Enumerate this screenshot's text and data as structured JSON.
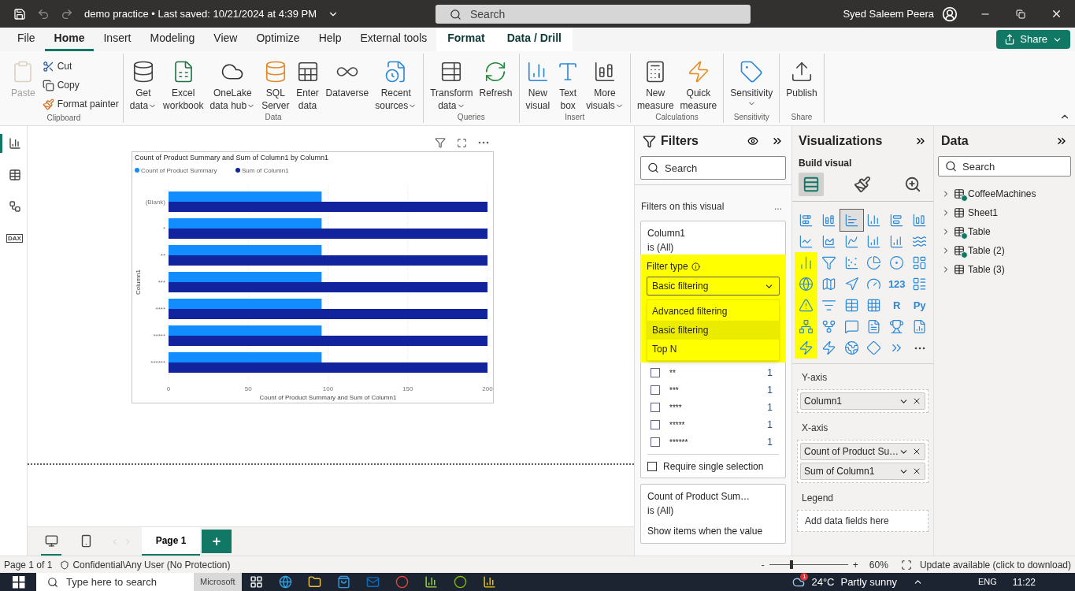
{
  "title_bar": {
    "title": "demo practice • Last saved: 10/21/2024 at 4:39 PM",
    "search": {
      "placeholder": "Search"
    },
    "user": "Syed Saleem Peera"
  },
  "ribbon_tabs": [
    {
      "label": "File",
      "kind": "normal",
      "selected": false
    },
    {
      "label": "Home",
      "kind": "normal",
      "selected": true
    },
    {
      "label": "Insert",
      "kind": "normal",
      "selected": false
    },
    {
      "label": "Modeling",
      "kind": "normal",
      "selected": false
    },
    {
      "label": "View",
      "kind": "normal",
      "selected": false
    },
    {
      "label": "Optimize",
      "kind": "normal",
      "selected": false
    },
    {
      "label": "Help",
      "kind": "normal",
      "selected": false
    },
    {
      "label": "External tools",
      "kind": "normal",
      "selected": false
    },
    {
      "label": "Format",
      "kind": "contextual",
      "selected": false
    },
    {
      "label": "Data / Drill",
      "kind": "contextual",
      "selected": false
    }
  ],
  "share_button": "Share",
  "ribbon_groups": [
    {
      "name": "Clipboard",
      "buttons": [
        {
          "kind": "large",
          "lines": [
            "Paste"
          ],
          "dropdown": false,
          "disabled": true
        },
        {
          "kind": "small",
          "lines": [
            "Cut"
          ],
          "dropdown": false,
          "disabled": false
        },
        {
          "kind": "small",
          "lines": [
            "Copy"
          ],
          "dropdown": false,
          "disabled": false
        },
        {
          "kind": "small",
          "lines": [
            "Format painter"
          ],
          "dropdown": false,
          "disabled": false
        }
      ]
    },
    {
      "name": "Data",
      "buttons": [
        {
          "kind": "large",
          "lines": [
            "Get",
            "data"
          ],
          "dropdown": true,
          "disabled": false
        },
        {
          "kind": "large",
          "lines": [
            "Excel",
            "workbook"
          ],
          "dropdown": false,
          "disabled": false
        },
        {
          "kind": "large",
          "lines": [
            "OneLake",
            "data hub"
          ],
          "dropdown": true,
          "disabled": false
        },
        {
          "kind": "large",
          "lines": [
            "SQL",
            "Server"
          ],
          "dropdown": false,
          "disabled": false
        },
        {
          "kind": "large",
          "lines": [
            "Enter",
            "data"
          ],
          "dropdown": false,
          "disabled": false
        },
        {
          "kind": "large",
          "lines": [
            "Dataverse"
          ],
          "dropdown": false,
          "disabled": false
        },
        {
          "kind": "large",
          "lines": [
            "Recent",
            "sources"
          ],
          "dropdown": true,
          "disabled": false
        }
      ]
    },
    {
      "name": "Queries",
      "buttons": [
        {
          "kind": "large",
          "lines": [
            "Transform",
            "data"
          ],
          "dropdown": true,
          "disabled": false
        },
        {
          "kind": "large",
          "lines": [
            "Refresh"
          ],
          "dropdown": false,
          "disabled": false
        }
      ]
    },
    {
      "name": "Insert",
      "buttons": [
        {
          "kind": "large",
          "lines": [
            "New",
            "visual"
          ],
          "dropdown": false,
          "disabled": false
        },
        {
          "kind": "large",
          "lines": [
            "Text",
            "box"
          ],
          "dropdown": false,
          "disabled": false
        },
        {
          "kind": "large",
          "lines": [
            "More",
            "visuals"
          ],
          "dropdown": true,
          "disabled": false
        }
      ]
    },
    {
      "name": "Calculations",
      "buttons": [
        {
          "kind": "large",
          "lines": [
            "New",
            "measure"
          ],
          "dropdown": false,
          "disabled": false
        },
        {
          "kind": "large",
          "lines": [
            "Quick",
            "measure"
          ],
          "dropdown": false,
          "disabled": false
        }
      ]
    },
    {
      "name": "Sensitivity",
      "buttons": [
        {
          "kind": "large",
          "lines": [
            "Sensitivity"
          ],
          "dropdown": true,
          "disabled": false
        }
      ]
    },
    {
      "name": "Share",
      "buttons": [
        {
          "kind": "large",
          "lines": [
            "Publish"
          ],
          "dropdown": false,
          "disabled": false
        }
      ]
    }
  ],
  "view_rail": [
    {
      "selected": true
    },
    {
      "selected": false
    },
    {
      "selected": false
    },
    {
      "selected": false,
      "label": "DAX"
    }
  ],
  "chart_data": {
    "type": "bar",
    "orientation": "horizontal",
    "title": "Count of Product Summary and Sum of Column1 by Column1",
    "xlabel": "Count of Product Summary and Sum of Column1",
    "ylabel": "Column1",
    "categories": [
      "(Blank)",
      "*",
      "**",
      "***",
      "****",
      "*****",
      "******"
    ],
    "series": [
      {
        "name": "Count of Product Summary",
        "color": "#118dff",
        "values": [
          96,
          96,
          96,
          96,
          96,
          96,
          96
        ]
      },
      {
        "name": "Sum of Column1",
        "color": "#12239e",
        "values": [
          200,
          200,
          200,
          200,
          200,
          200,
          200
        ]
      }
    ],
    "xlim": [
      0,
      200
    ],
    "xticks": [
      0,
      50,
      100,
      150,
      200
    ],
    "legend": "top",
    "grid": true
  },
  "page_bar": {
    "layouts": [
      {
        "selected": true
      },
      {
        "selected": false
      }
    ],
    "pages": [
      {
        "label": "Page 1",
        "selected": true
      }
    ],
    "add": "+"
  },
  "filters": {
    "title": "Filters",
    "search": {
      "placeholder": "Search"
    },
    "section": "Filters on this visual",
    "more": "...",
    "cards": [
      {
        "kind": "column",
        "field": "Column1",
        "state": "is (All)",
        "filter_type": {
          "label": "Filter type",
          "value": "Basic filtering",
          "highlighted": true,
          "expanded": true,
          "options": [
            {
              "label": "Advanced filtering",
              "selected": false
            },
            {
              "label": "Basic filtering",
              "selected": true
            },
            {
              "label": "Top N",
              "selected": false
            }
          ]
        },
        "items": [
          {
            "label": "**",
            "count": "1",
            "checked": false
          },
          {
            "label": "***",
            "count": "1",
            "checked": false
          },
          {
            "label": "****",
            "count": "1",
            "checked": false
          },
          {
            "label": "*****",
            "count": "1",
            "checked": false
          },
          {
            "label": "******",
            "count": "1",
            "checked": false
          }
        ],
        "single": {
          "label": "Require single selection",
          "checked": false
        }
      },
      {
        "kind": "measure",
        "field": "Count of Product Sum…",
        "state": "is (All)",
        "hint": "Show items when the value"
      }
    ]
  },
  "visualizations": {
    "title": "Visualizations",
    "subtitle": "Build visual",
    "build_tabs": [
      {
        "selected": true
      },
      {
        "selected": false
      },
      {
        "selected": false
      }
    ],
    "icons": [
      {
        "kind": "stacked-bar",
        "selected": false,
        "highlighted": false
      },
      {
        "kind": "stacked-column",
        "selected": false,
        "highlighted": false
      },
      {
        "kind": "clustered-bar",
        "selected": true,
        "highlighted": false
      },
      {
        "kind": "clustered-column",
        "selected": false,
        "highlighted": false
      },
      {
        "kind": "full-bar",
        "selected": false,
        "highlighted": false
      },
      {
        "kind": "full-column",
        "selected": false,
        "highlighted": false
      },
      {
        "kind": "line",
        "selected": false,
        "highlighted": false
      },
      {
        "kind": "area",
        "selected": false,
        "highlighted": false
      },
      {
        "kind": "stacked-area",
        "selected": false,
        "highlighted": false
      },
      {
        "kind": "line-column",
        "selected": false,
        "highlighted": false
      },
      {
        "kind": "line-column",
        "selected": false,
        "highlighted": false
      },
      {
        "kind": "ribbon",
        "selected": false,
        "highlighted": false
      },
      {
        "kind": "waterfall",
        "selected": false,
        "highlighted": true
      },
      {
        "kind": "funnel",
        "selected": false,
        "highlighted": false
      },
      {
        "kind": "scatter",
        "selected": false,
        "highlighted": false
      },
      {
        "kind": "pie",
        "selected": false,
        "highlighted": false
      },
      {
        "kind": "donut",
        "selected": false,
        "highlighted": false
      },
      {
        "kind": "treemap",
        "selected": false,
        "highlighted": false
      },
      {
        "kind": "globe",
        "selected": false,
        "highlighted": true
      },
      {
        "kind": "map",
        "selected": false,
        "highlighted": false
      },
      {
        "kind": "navigation",
        "selected": false,
        "highlighted": false
      },
      {
        "kind": "gauge",
        "selected": false,
        "highlighted": false
      },
      {
        "kind": "label",
        "text": "123",
        "selected": false,
        "highlighted": false
      },
      {
        "kind": "multi-card",
        "selected": false,
        "highlighted": false
      },
      {
        "kind": "kpi",
        "selected": false,
        "highlighted": true
      },
      {
        "kind": "slicer",
        "selected": false,
        "highlighted": false
      },
      {
        "kind": "table",
        "selected": false,
        "highlighted": false
      },
      {
        "kind": "matrix",
        "selected": false,
        "highlighted": false
      },
      {
        "kind": "label",
        "text": "R",
        "selected": false,
        "highlighted": false
      },
      {
        "kind": "label",
        "text": "Py",
        "selected": false,
        "highlighted": false
      },
      {
        "kind": "influencers",
        "selected": false,
        "highlighted": true
      },
      {
        "kind": "tree",
        "selected": false,
        "highlighted": false
      },
      {
        "kind": "chat",
        "selected": false,
        "highlighted": false
      },
      {
        "kind": "document",
        "selected": false,
        "highlighted": false
      },
      {
        "kind": "trophy",
        "selected": false,
        "highlighted": false
      },
      {
        "kind": "report",
        "selected": false,
        "highlighted": false
      },
      {
        "kind": "zap",
        "selected": false,
        "highlighted": true
      },
      {
        "kind": "zap-slicer",
        "selected": false,
        "highlighted": false
      },
      {
        "kind": "earth",
        "selected": false,
        "highlighted": false
      },
      {
        "kind": "diamond",
        "selected": false,
        "highlighted": false
      },
      {
        "kind": "chevrons",
        "selected": false,
        "highlighted": false
      },
      {
        "kind": "more",
        "selected": false,
        "highlighted": false
      }
    ],
    "wells": [
      {
        "label": "Y-axis",
        "fields": [
          "Column1"
        ]
      },
      {
        "label": "X-axis",
        "fields": [
          "Count of Product Su…",
          "Sum of Column1"
        ]
      },
      {
        "label": "Legend",
        "placeholder": "Add data fields here"
      }
    ]
  },
  "data_pane": {
    "title": "Data",
    "search": {
      "placeholder": "Search"
    },
    "tables": [
      {
        "name": "CoffeeMachines",
        "in_use": true
      },
      {
        "name": "Sheet1",
        "in_use": false
      },
      {
        "name": "Table",
        "in_use": true
      },
      {
        "name": "Table (2)",
        "in_use": true
      },
      {
        "name": "Table (3)",
        "in_use": false
      }
    ]
  },
  "status_bar": {
    "page": "Page 1 of 1",
    "sensitivity": "Confidential\\Any User (No Protection)",
    "zoom": {
      "minus": "-",
      "plus": "+",
      "level": 0.27,
      "reading": "60%"
    },
    "update": "Update available (click to download)"
  },
  "taskbar": {
    "search": "Type here to search",
    "pinned": "Microsoft",
    "weather_badge": "1",
    "temperature": "24°C",
    "weather": "Partly sunny",
    "language": "ENG",
    "time": "11:22"
  }
}
